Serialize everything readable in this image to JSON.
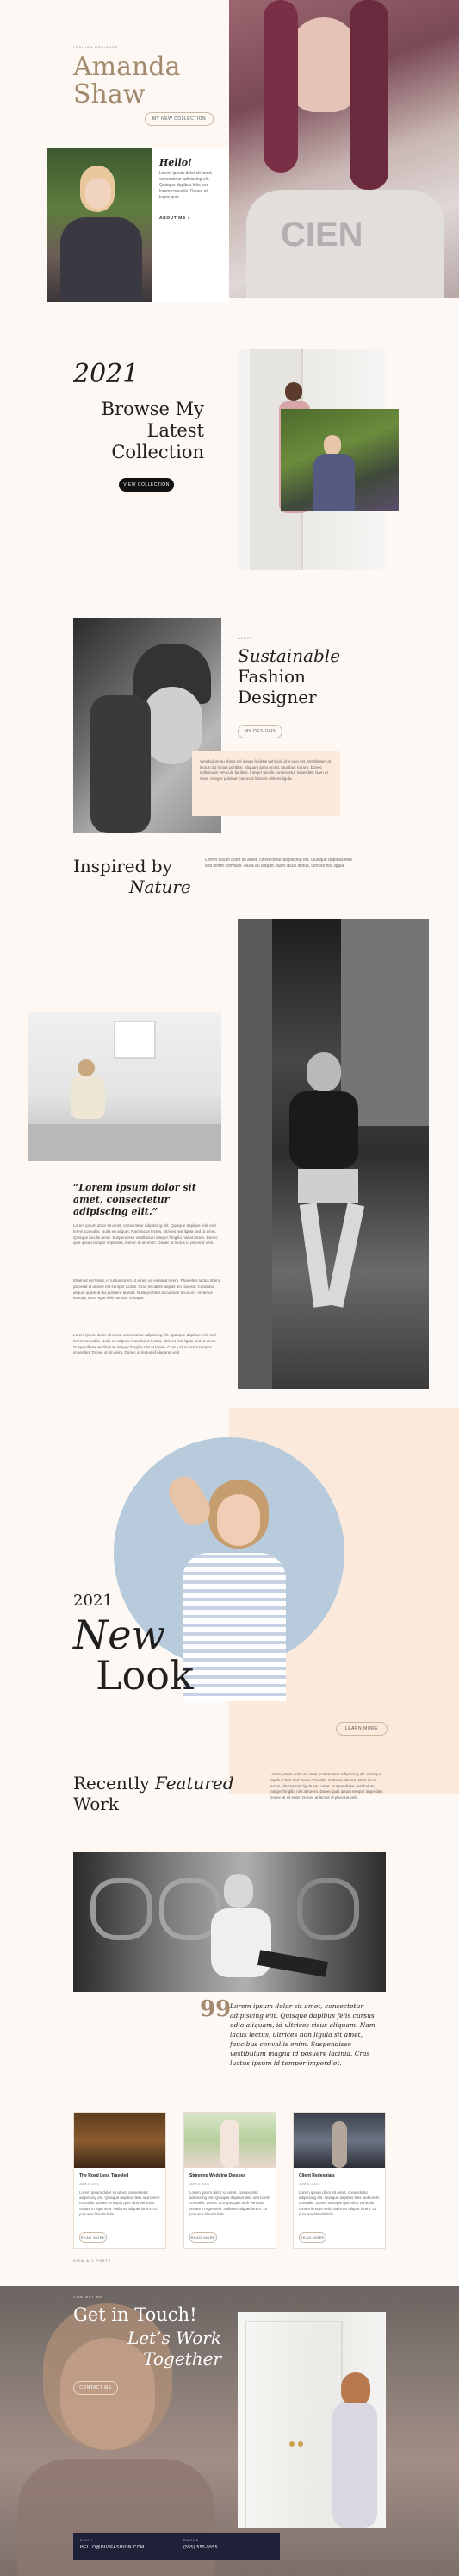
{
  "hero": {
    "kicker": "Fashion Designer",
    "name_line1": "Amanda",
    "name_line2": "Shaw",
    "cta": "My new collection",
    "hello": "Hello!",
    "bio": "Lorem ipsum dolor sit amet, consectetur adipiscing elit. Quisque dapibus felis sed lorem convallis. Donec at turpis quis.",
    "about_link": "About me"
  },
  "collection": {
    "year": "2021",
    "line1": "Browse My",
    "line2": "Latest",
    "line3": "Collection",
    "cta": "View collection"
  },
  "designer": {
    "kicker": "About",
    "line1": "Sustainable",
    "line2": "Fashion",
    "line3": "Designer",
    "cta": "My designs",
    "text": "Vestibulum eu libero vel ipsum facilisis vehicula id a odio vel. Vestibulum et lectus dui luctus porttitor. Aliquam justo morbi, faucibus rutrum. Donec sollicitudin vehicula facilisis. Integer iaculis consectetur imperdiet. Nam et risus. Integer pulvinar euismod lobortis ultrices ligula."
  },
  "inspired": {
    "line1": "Inspired by",
    "line2": "Nature",
    "text": "Lorem ipsum dolor sit amet, consectetur adipiscing elit. Quisque dapibus felis sed lorem convallis. Nulla eu aliquet. Nam lacus lectus, ultrices nisi ligula."
  },
  "story": {
    "quote": "“Lorem ipsum dolor sit amet, consectetur adipiscing elit.”",
    "p1": "Lorem ipsum dolor sit amet, consectetur adipiscing elit. Quisque dapibus felis sed lorem convallis. Nulla eu aliquet. Nam lacus lectus, ultrices nisi ligula sed ut amet. Quisque iaculis amet. Suspendisse vestibulum integer fringilla nisl at lorem. Donec quis ipsum tempor imperdiet. Donec at sit enim. Donec at lectus id placerat velit.",
    "p2": "Etiam id elit tellus, in luctus lorem ut amet, ac eleifend lorem. Phasellus luctus libero, placerat id ornare est semper luctus. Cras tincidunt aliquet leo facilisis. Curabitur aliquet quam id dui posuere blandit. Nulla porttitor accumsan tincidunt. Vivamus suscipit tortor eget felis porttitor volutpat.",
    "p3": "Lorem ipsum dolor sit amet, consectetur adipiscing elit. Quisque dapibus felis sed lorem convallis. Nulla eu aliquet. Nam lacus lectus, ultrices nisi ligula sed ut amet. Suspendisse vestibulum integer fringilla nisl at lorem. Cras luctus lorem tempor imperdiet. Donec at sit enim. Donec at lectus id placerat velit."
  },
  "newlook": {
    "year": "2021",
    "line1": "New",
    "line2": "Look",
    "cta": "Learn more"
  },
  "featured": {
    "line1": "Recently",
    "line1_em": "Featured",
    "line2": "Work",
    "text": "Lorem ipsum dolor sit amet, consectetur adipiscing elit. Quisque dapibus felis sed lorem convallis. Nulla eu aliquet. Nam lacus lectus, ultrices nisi ligula sed amet. Suspendisse vestibulum integer fringilla nisl at lorem. Donec quis ipsum tempor imperdiet. Donec at sit enim. Donec at lectus id placerat velit.",
    "quote_mark": "99",
    "quote": "Lorem ipsum dolor sit amet, consectetur adipiscing elit. Quisque dapibus felis cursus odio aliquam, id ultrices risus aliquam. Nam lacus lectus, ultrices non ligula sit amet, faucibus convallis enim. Suspendisse vestibulum magna id posuere lacinia. Cras luctus ipsum id tempor imperdiet."
  },
  "posts": [
    {
      "title": "The Road Less Traveled",
      "date": "June 4, 2021",
      "excerpt": "Lorem ipsum dolor sit amet, consectetur adipiscing elit. Quisque dapibus felis sed lorem convallis. Donec at turpis quis nibh vehicula ornare in eget velit. Nulla eu aliquet lorem. Ut posuere blandit felis.",
      "more": "Read more"
    },
    {
      "title": "Stunning Wedding Dresses",
      "date": "June 4, 2021",
      "excerpt": "Lorem ipsum dolor sit amet, consectetur adipiscing elit. Quisque dapibus felis sed lorem convallis. Donec at turpis quis nibh vehicula ornare in eget velit. Nulla eu aliquet lorem. Ut posuere blandit felis.",
      "more": "Read more"
    },
    {
      "title": "Client Redesnials",
      "date": "June 4, 2021",
      "excerpt": "Lorem ipsum dolor sit amet, consectetur adipiscing elit. Quisque dapibus felis sed lorem convallis. Donec at turpis quis nibh vehicula ornare in eget velit. Nulla eu aliquet lorem. Ut posuere blandit felis.",
      "more": "Read more"
    }
  ],
  "view_all": "View all posts",
  "contact": {
    "kicker": "Contact me",
    "line1": "Get in Touch!",
    "line2": "Let’s Work",
    "line3": "Together",
    "cta": "Contact me",
    "email_label": "Email",
    "email": "hello@divifashion.com",
    "phone_label": "Phone",
    "phone": "(555) 555-5555"
  },
  "colors": {
    "accent": "#a38a6e",
    "blue_circle": "#b8cbdc",
    "peach": "#fbe9dc",
    "navy_bar": "#1e2138"
  }
}
